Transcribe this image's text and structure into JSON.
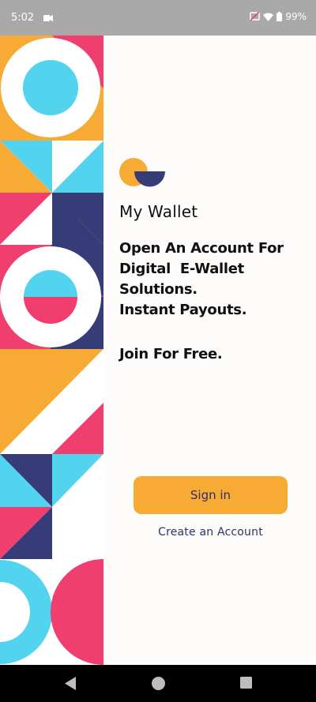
{
  "status_bar": {
    "time": "5:02",
    "battery": "99%",
    "icons": [
      "video-icon",
      "cast-off-icon",
      "wifi-icon",
      "battery-icon"
    ]
  },
  "app": {
    "title": "My Wallet",
    "tagline_lines": [
      "Open An Account For",
      "Digital  E-Wallet",
      "Solutions.",
      "Instant Payouts."
    ],
    "join_text": "Join For Free."
  },
  "actions": {
    "sign_in_label": "Sign in",
    "create_account_label": "Create an Account"
  },
  "nav_bar": {
    "buttons": [
      "back-icon",
      "home-icon",
      "recents-icon"
    ]
  },
  "colors": {
    "orange": "#f7ab34",
    "pink": "#f03e6e",
    "cyan": "#52d3ee",
    "navy": "#363c78",
    "background": "#fdfcfa"
  }
}
